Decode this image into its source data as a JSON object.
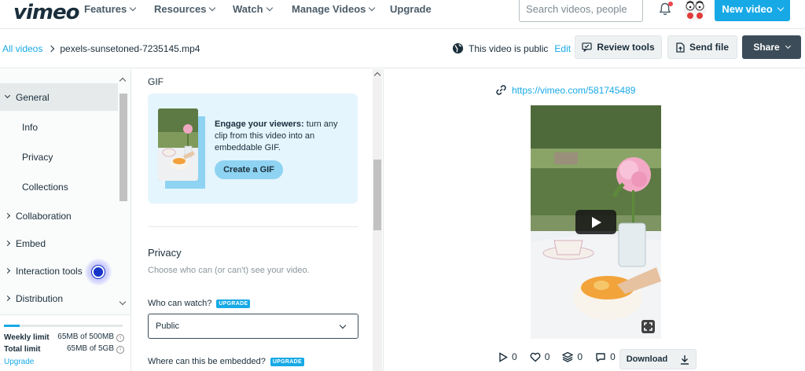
{
  "nav": {
    "logo": "vimeo",
    "items": [
      {
        "label": "Features",
        "has_menu": true
      },
      {
        "label": "Resources",
        "has_menu": true
      },
      {
        "label": "Watch",
        "has_menu": true
      },
      {
        "label": "Manage Videos",
        "has_menu": true
      },
      {
        "label": "Upgrade",
        "has_menu": false
      }
    ],
    "search_placeholder": "Search videos, people",
    "new_video_label": "New video"
  },
  "subheader": {
    "breadcrumb_root": "All videos",
    "breadcrumb_file": "pexels-sunsetoned-7235145.mp4",
    "public_text": "This video is public",
    "edit_label": "Edit",
    "review_tools_label": "Review tools",
    "send_file_label": "Send file",
    "share_label": "Share"
  },
  "sidebar": {
    "items": [
      {
        "label": "General",
        "kind": "group",
        "expanded": true,
        "active": true
      },
      {
        "label": "Info",
        "kind": "sub"
      },
      {
        "label": "Privacy",
        "kind": "sub"
      },
      {
        "label": "Collections",
        "kind": "sub"
      },
      {
        "label": "Collaboration",
        "kind": "group",
        "expanded": false
      },
      {
        "label": "Embed",
        "kind": "group",
        "expanded": false
      },
      {
        "label": "Interaction tools",
        "kind": "group",
        "expanded": false
      },
      {
        "label": "Distribution",
        "kind": "group",
        "expanded": false
      }
    ],
    "storage": {
      "weekly_label": "Weekly limit",
      "weekly_value": "65MB of 500MB",
      "total_label": "Total limit",
      "total_value": "65MB of 5GB",
      "upgrade_label": "Upgrade",
      "usage_fraction": 0.13
    }
  },
  "gif": {
    "section_title": "GIF",
    "headline": "Engage your viewers:",
    "body": " turn any clip from this video into an embeddable GIF.",
    "button_label": "Create a GIF"
  },
  "privacy": {
    "title": "Privacy",
    "subtitle": "Choose who can (or can't) see your video.",
    "who_label": "Who can watch?",
    "who_badge": "UPGRADE",
    "who_value": "Public",
    "embed_label": "Where can this be embedded?",
    "embed_badge": "UPGRADE"
  },
  "player": {
    "link": "https://vimeo.com/581745489",
    "plays": "0",
    "likes": "0",
    "collections": "0",
    "comments": "0",
    "download_label": "Download"
  },
  "colors": {
    "accent": "#17a9e6",
    "dark_button": "#3c4d59",
    "text": "#1a2e3b"
  }
}
